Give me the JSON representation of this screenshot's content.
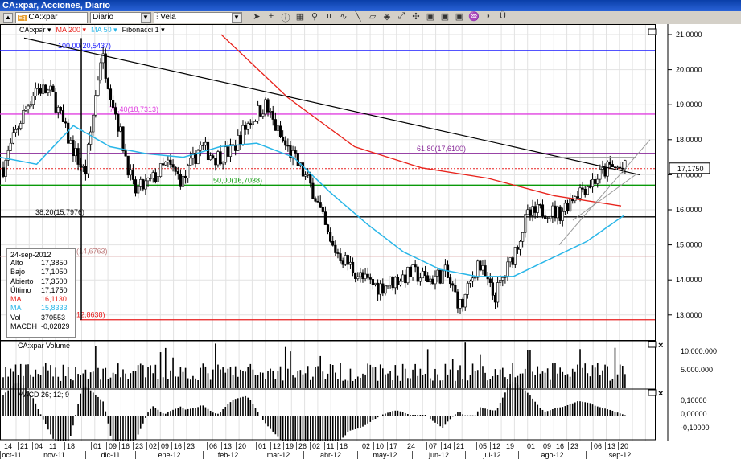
{
  "window": {
    "title": "CA:xpar, Acciones, Diario"
  },
  "toolbar": {
    "symbol": "CA:xpar",
    "period": "Diario",
    "chart_type": "Vela",
    "icons": [
      "pointer-icon",
      "crosshair-icon",
      "info-icon",
      "grid-icon",
      "zoom-icon",
      "bars-icon",
      "indicator-icon",
      "line-draw-icon",
      "eraser-icon",
      "object-icon",
      "autoscale-icon",
      "compare-icon",
      "window1-icon",
      "window2-icon",
      "window3-icon",
      "wave-icon",
      "sound-icon",
      "magnet-icon"
    ]
  },
  "legend": {
    "symbol": "CA:xpar ▾",
    "ma200": "MA 200 ▾",
    "ma50": "MA 50 ▾",
    "fib": "Fibonacci 1 ▾"
  },
  "colors": {
    "ma200": "#e8231c",
    "ma50": "#29b6e8",
    "fib100": "#1a1aff",
    "fib76": "#e040e0",
    "fib61": "#8a2a9a",
    "fib50": "#0a9a0a",
    "fib38": "#000000",
    "fib23": "#d8a0a0",
    "fib0": "#e82020",
    "price_line": "#e82020"
  },
  "fibonacci": [
    {
      "label": "100,00(20,5437)",
      "price": 20.5437,
      "color": "#1a1aff"
    },
    {
      "label": "76,40(18,7313)",
      "price": 18.7313,
      "color": "#e040e0"
    },
    {
      "label": "61,80(17,6100)",
      "price": 17.61,
      "color": "#8a2a9a"
    },
    {
      "label": "50,00(16,7038)",
      "price": 16.7038,
      "color": "#0a9a0a"
    },
    {
      "label": "38,20(15,7976)",
      "price": 15.7976,
      "color": "#000000"
    },
    {
      "label": "0(14,6763)",
      "price": 14.6763,
      "color": "#d8a0a0"
    },
    {
      "label": "(12,8638)",
      "price": 12.8638,
      "color": "#e82020"
    }
  ],
  "price_axis": {
    "ticks": [
      "21,0000",
      "20,0000",
      "19,0000",
      "18,0000",
      "17,0000",
      "16,0000",
      "15,0000",
      "14,0000",
      "13,0000"
    ],
    "last": "17,1750",
    "last_value": 17.175,
    "range": [
      12.6,
      21.3
    ]
  },
  "info": {
    "date": "24-sep-2012",
    "rows": [
      {
        "k": "Alto",
        "v": "17,3850",
        "c": "#000"
      },
      {
        "k": "Bajo",
        "v": "17,1050",
        "c": "#000"
      },
      {
        "k": "Abierto",
        "v": "17,3500",
        "c": "#000"
      },
      {
        "k": "Último",
        "v": "17,1750",
        "c": "#000"
      },
      {
        "k": "MA",
        "v": "16,1130",
        "c": "#e8231c"
      },
      {
        "k": "MA",
        "v": "15,8333",
        "c": "#29b6e8"
      },
      {
        "k": "Vol",
        "v": "370553",
        "c": "#000"
      },
      {
        "k": "MACDH",
        "v": "-0,02829",
        "c": "#000"
      }
    ]
  },
  "volume": {
    "title": "CA:xpar Volume",
    "ticks": [
      "10.000.000",
      "5.000.000"
    ]
  },
  "macd": {
    "title": "MACD 26; 12; 9",
    "ticks": [
      "0,10000",
      "0,00000",
      "-0,10000"
    ]
  },
  "dates": {
    "days": [
      "14",
      "21",
      "04",
      "11",
      "18",
      "01",
      "09",
      "16",
      "23",
      "02",
      "09",
      "16",
      "23",
      "06",
      "13",
      "20",
      "01",
      "12",
      "19",
      "26",
      "02",
      "11",
      "18",
      "02",
      "10",
      "17",
      "24",
      "07",
      "14",
      "21",
      "05",
      "12",
      "19",
      "01",
      "09",
      "16",
      "23",
      "06",
      "13",
      "20"
    ],
    "months": [
      "oct-11",
      "nov-11",
      "dic-11",
      "ene-12",
      "feb-12",
      "mar-12",
      "abr-12",
      "may-12",
      "jun-12",
      "jul-12",
      "ago-12",
      "sep-12"
    ]
  },
  "chart_data": {
    "type": "candlestick",
    "close_anchors": [
      17.2,
      18.5,
      19.5,
      19.3,
      18.0,
      17.0,
      20.5,
      18.5,
      16.5,
      16.8,
      17.3,
      16.8,
      17.8,
      17.5,
      17.7,
      18.5,
      19.0,
      18.0,
      17.3,
      16.5,
      15.0,
      14.5,
      14.0,
      13.8,
      14.0,
      14.2,
      14.0,
      14.2,
      13.2,
      14.5,
      13.5,
      14.5,
      15.8,
      16.0,
      15.9,
      16.5,
      16.8,
      17.2,
      17.175
    ],
    "ma200": [
      21.0,
      19.2,
      17.8,
      17.2,
      16.9,
      16.4,
      16.11
    ],
    "ma50": [
      17.5,
      17.3,
      18.4,
      17.8,
      17.6,
      17.5,
      17.8,
      17.9,
      17.5,
      16.5,
      15.6,
      14.8,
      14.3,
      14.1,
      14.1,
      14.6,
      15.1,
      15.83
    ]
  }
}
